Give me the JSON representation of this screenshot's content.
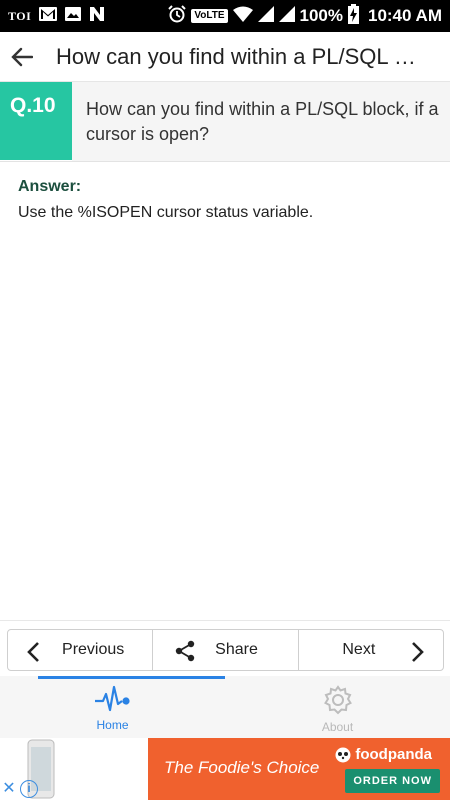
{
  "status_bar": {
    "carrier_label": "TOI",
    "network_label": "VoLTE",
    "battery_percent": "100%",
    "time": "10:40 AM",
    "icons": [
      "toi-icon",
      "gmail-icon",
      "image-icon",
      "n-icon",
      "alarm-icon",
      "volte-icon",
      "wifi-icon",
      "signal-icon",
      "signal-icon",
      "battery-charging-icon"
    ]
  },
  "app_bar": {
    "title": "How can you find within a PL/SQL block, if a cursor is open?",
    "back_icon": "arrow-left-icon"
  },
  "question": {
    "number": "Q.10",
    "text": "How can you find within a PL/SQL block, if a cursor is open?",
    "badge_color": "#26c6a2"
  },
  "answer": {
    "label": "Answer:",
    "text": "Use the %ISOPEN cursor status variable."
  },
  "pager": {
    "previous_label": "Previous",
    "share_label": "Share",
    "next_label": "Next"
  },
  "bottom_nav": {
    "tabs": [
      {
        "label": "Home",
        "icon": "pulse-icon",
        "active": true
      },
      {
        "label": "About",
        "icon": "gear-icon",
        "active": false
      }
    ],
    "accent_color": "#2a82e4"
  },
  "ad": {
    "tagline": "The Foodie's Choice",
    "brand": "foodpanda",
    "cta": "ORDER NOW",
    "background_color": "#f0612e"
  }
}
